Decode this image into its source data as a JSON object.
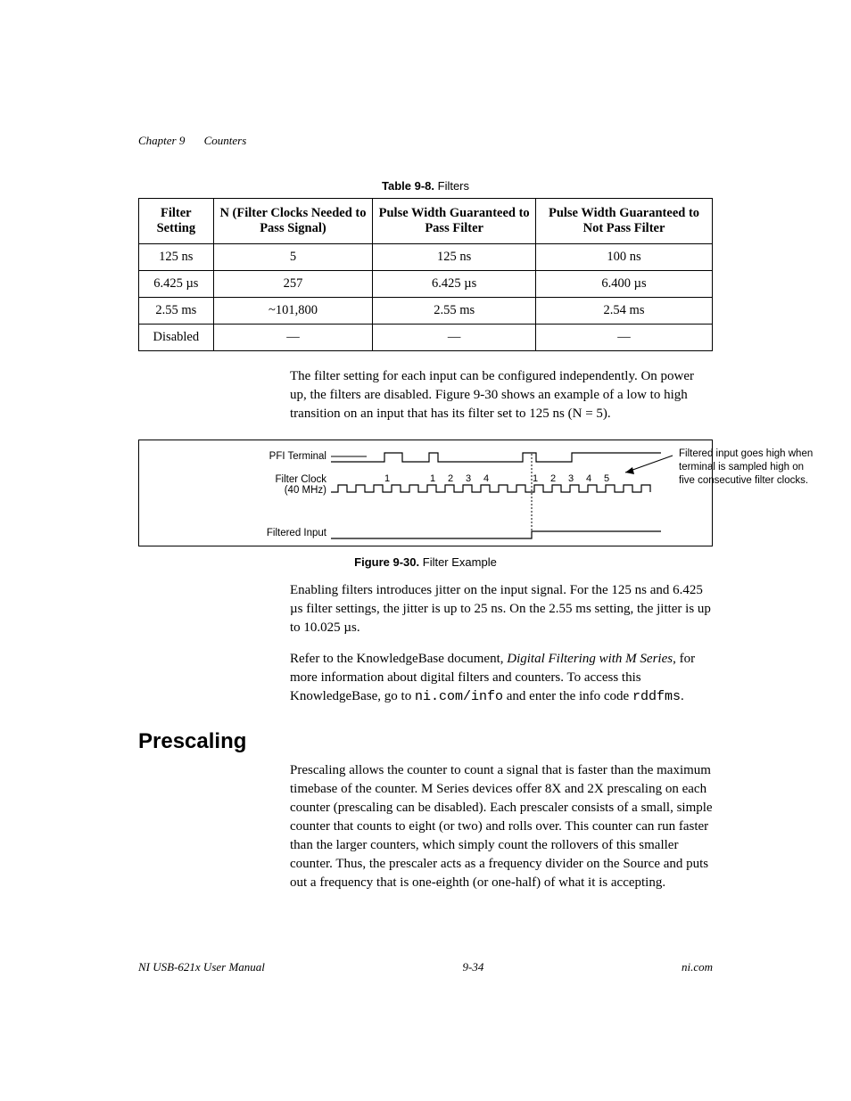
{
  "running_head": {
    "chapter": "Chapter 9",
    "title": "Counters"
  },
  "table": {
    "caption_label": "Table 9-8.",
    "caption_text": "Filters",
    "headers": [
      "Filter Setting",
      "N (Filter Clocks Needed to Pass Signal)",
      "Pulse Width Guaranteed to Pass Filter",
      "Pulse Width Guaranteed to Not Pass Filter"
    ],
    "rows": [
      [
        "125 ns",
        "5",
        "125 ns",
        "100 ns"
      ],
      [
        "6.425 µs",
        "257",
        "6.425 µs",
        "6.400 µs"
      ],
      [
        "2.55 ms",
        "~101,800",
        "2.55 ms",
        "2.54 ms"
      ],
      [
        "Disabled",
        "—",
        "—",
        "—"
      ]
    ]
  },
  "para1": "The filter setting for each input can be configured independently. On power up, the filters are disabled. Figure 9-30 shows an example of a low to high transition on an input that has its filter set to 125 ns (N = 5).",
  "figure": {
    "label_pfi": "PFI Terminal",
    "label_clk1": "Filter Clock",
    "label_clk2": "(40 MHz)",
    "label_filtered": "Filtered Input",
    "annotation": "Filtered input goes high when terminal is sampled high on five consecutive filter clocks.",
    "clock_numbers_a": [
      "1",
      "1",
      "2",
      "3",
      "4",
      "1",
      "2",
      "3",
      "4",
      "5"
    ],
    "caption_label": "Figure 9-30.",
    "caption_text": "Filter Example"
  },
  "para2": "Enabling filters introduces jitter on the input signal. For the 125 ns and 6.425 µs filter settings, the jitter is up to 25 ns. On the 2.55 ms setting, the jitter is up to 10.025 µs.",
  "para3_a": "Refer to the KnowledgeBase document, ",
  "para3_kb": "Digital Filtering with M Series",
  "para3_b": ", for more information about digital filters and counters. To access this KnowledgeBase, go to ",
  "para3_code1": "ni.com/info",
  "para3_c": " and enter the info code ",
  "para3_code2": "rddfms",
  "para3_d": ".",
  "section_heading": "Prescaling",
  "para4": "Prescaling allows the counter to count a signal that is faster than the maximum timebase of the counter. M Series devices offer 8X and 2X prescaling on each counter (prescaling can be disabled). Each prescaler consists of a small, simple counter that counts to eight (or two) and rolls over. This counter can run faster than the larger counters, which simply count the rollovers of this smaller counter. Thus, the prescaler acts as a frequency divider on the Source and puts out a frequency that is one-eighth (or one-half) of what it is accepting.",
  "footer": {
    "left": "NI USB-621x User Manual",
    "center": "9-34",
    "right": "ni.com"
  }
}
